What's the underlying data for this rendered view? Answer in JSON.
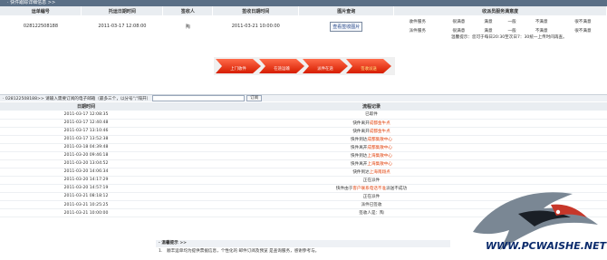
{
  "top_bar": {
    "title": "· 快件跟踪详细信息 >>"
  },
  "orders": {
    "headers": [
      "运单编号",
      "托运日期时间",
      "签收人",
      "签收日期时间",
      "图片查询",
      "收派员服务满意度"
    ],
    "row": {
      "waybill": "028122508188",
      "ship_time": "2011-03-17 12:08:00",
      "signer": "陶",
      "sign_time": "2011-03-21 10:00:00",
      "photo_button": "查看签收图片"
    },
    "rating": {
      "rows": [
        {
          "label": "收件服务",
          "options": [
            "很满意",
            "满意",
            "一般",
            "不满意",
            "很不满意"
          ]
        },
        {
          "label": "派件服务",
          "options": [
            "很满意",
            "满意",
            "一般",
            "不满意",
            "很不满意"
          ]
        }
      ]
    },
    "notice": "温馨提示：您可于每日20:30至次日7：30统一上传时间再查。"
  },
  "progress": {
    "steps": [
      "上门收件",
      "在途运输",
      "派件在途",
      "签收派送"
    ],
    "active_index": 3
  },
  "query": {
    "label": "· 028122508188>> 请输入需要订阅的电子邮箱（最多三个，以分号\";\"隔开）",
    "input_value": "",
    "button": "订阅"
  },
  "tracking": {
    "headers": [
      "日期时间",
      "流程记录"
    ],
    "rows": [
      {
        "time": "2011-03-17 12:08:35",
        "pre": "已取件",
        "hl": "",
        "post": ""
      },
      {
        "time": "2011-03-17 12:40:48",
        "pre": "快件离开",
        "hl": "成都金牛点",
        "post": ""
      },
      {
        "time": "2011-03-17 13:10:46",
        "pre": "快件离开",
        "hl": "成都金牛点",
        "post": ""
      },
      {
        "time": "2011-03-17 13:52:38",
        "pre": "快件到达",
        "hl": "成都集散中心",
        "post": ""
      },
      {
        "time": "2011-03-18 04:39:48",
        "pre": "快件离开",
        "hl": "成都集散中心",
        "post": ""
      },
      {
        "time": "2011-03-20 09:46:18",
        "pre": "快件到达",
        "hl": "上海集散中心",
        "post": ""
      },
      {
        "time": "2011-03-20 13:04:52",
        "pre": "快件离开",
        "hl": "上海集散中心",
        "post": ""
      },
      {
        "time": "2011-03-20 14:06:34",
        "pre": "快件到达",
        "hl": "上海南翔点",
        "post": ""
      },
      {
        "time": "2011-03-20 14:17:29",
        "pre": "正在派件",
        "hl": "",
        "post": ""
      },
      {
        "time": "2011-03-20 14:57:19",
        "pre": "快件由于",
        "hl": "客户联系电话不准",
        "post": "派送不成功"
      },
      {
        "time": "2011-03-21 08:18:12",
        "pre": "正在派件",
        "hl": "",
        "post": ""
      },
      {
        "time": "2011-03-21 10:25:25",
        "pre": "派件已签收",
        "hl": "",
        "post": ""
      },
      {
        "time": "2011-03-21 10:00:00",
        "pre": "签收人是：陶",
        "hl": "",
        "post": ""
      }
    ]
  },
  "tips": {
    "title": "· 温馨提示 >>",
    "line": "1.　顺丰运单均为提供票据信息，个性化的 邮件订阅及预览 是查询服务，感谢参考与。"
  },
  "watermark": {
    "text": "WWW.PCWAISHE.NET"
  },
  "colors": {
    "header_bg": "#e9edf1",
    "highlight": "#e2440f",
    "arrow": "#d61d00",
    "topbar": "#5a6f86"
  }
}
